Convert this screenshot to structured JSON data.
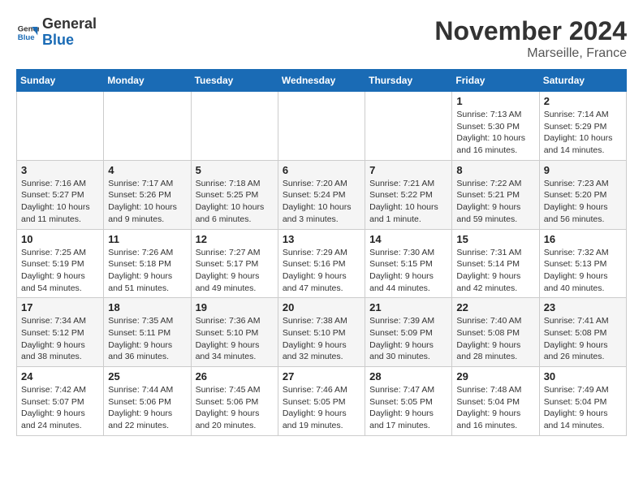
{
  "header": {
    "logo_general": "General",
    "logo_blue": "Blue",
    "month_title": "November 2024",
    "location": "Marseille, France"
  },
  "weekdays": [
    "Sunday",
    "Monday",
    "Tuesday",
    "Wednesday",
    "Thursday",
    "Friday",
    "Saturday"
  ],
  "weeks": [
    [
      {
        "day": "",
        "info": ""
      },
      {
        "day": "",
        "info": ""
      },
      {
        "day": "",
        "info": ""
      },
      {
        "day": "",
        "info": ""
      },
      {
        "day": "",
        "info": ""
      },
      {
        "day": "1",
        "info": "Sunrise: 7:13 AM\nSunset: 5:30 PM\nDaylight: 10 hours\nand 16 minutes."
      },
      {
        "day": "2",
        "info": "Sunrise: 7:14 AM\nSunset: 5:29 PM\nDaylight: 10 hours\nand 14 minutes."
      }
    ],
    [
      {
        "day": "3",
        "info": "Sunrise: 7:16 AM\nSunset: 5:27 PM\nDaylight: 10 hours\nand 11 minutes."
      },
      {
        "day": "4",
        "info": "Sunrise: 7:17 AM\nSunset: 5:26 PM\nDaylight: 10 hours\nand 9 minutes."
      },
      {
        "day": "5",
        "info": "Sunrise: 7:18 AM\nSunset: 5:25 PM\nDaylight: 10 hours\nand 6 minutes."
      },
      {
        "day": "6",
        "info": "Sunrise: 7:20 AM\nSunset: 5:24 PM\nDaylight: 10 hours\nand 3 minutes."
      },
      {
        "day": "7",
        "info": "Sunrise: 7:21 AM\nSunset: 5:22 PM\nDaylight: 10 hours\nand 1 minute."
      },
      {
        "day": "8",
        "info": "Sunrise: 7:22 AM\nSunset: 5:21 PM\nDaylight: 9 hours\nand 59 minutes."
      },
      {
        "day": "9",
        "info": "Sunrise: 7:23 AM\nSunset: 5:20 PM\nDaylight: 9 hours\nand 56 minutes."
      }
    ],
    [
      {
        "day": "10",
        "info": "Sunrise: 7:25 AM\nSunset: 5:19 PM\nDaylight: 9 hours\nand 54 minutes."
      },
      {
        "day": "11",
        "info": "Sunrise: 7:26 AM\nSunset: 5:18 PM\nDaylight: 9 hours\nand 51 minutes."
      },
      {
        "day": "12",
        "info": "Sunrise: 7:27 AM\nSunset: 5:17 PM\nDaylight: 9 hours\nand 49 minutes."
      },
      {
        "day": "13",
        "info": "Sunrise: 7:29 AM\nSunset: 5:16 PM\nDaylight: 9 hours\nand 47 minutes."
      },
      {
        "day": "14",
        "info": "Sunrise: 7:30 AM\nSunset: 5:15 PM\nDaylight: 9 hours\nand 44 minutes."
      },
      {
        "day": "15",
        "info": "Sunrise: 7:31 AM\nSunset: 5:14 PM\nDaylight: 9 hours\nand 42 minutes."
      },
      {
        "day": "16",
        "info": "Sunrise: 7:32 AM\nSunset: 5:13 PM\nDaylight: 9 hours\nand 40 minutes."
      }
    ],
    [
      {
        "day": "17",
        "info": "Sunrise: 7:34 AM\nSunset: 5:12 PM\nDaylight: 9 hours\nand 38 minutes."
      },
      {
        "day": "18",
        "info": "Sunrise: 7:35 AM\nSunset: 5:11 PM\nDaylight: 9 hours\nand 36 minutes."
      },
      {
        "day": "19",
        "info": "Sunrise: 7:36 AM\nSunset: 5:10 PM\nDaylight: 9 hours\nand 34 minutes."
      },
      {
        "day": "20",
        "info": "Sunrise: 7:38 AM\nSunset: 5:10 PM\nDaylight: 9 hours\nand 32 minutes."
      },
      {
        "day": "21",
        "info": "Sunrise: 7:39 AM\nSunset: 5:09 PM\nDaylight: 9 hours\nand 30 minutes."
      },
      {
        "day": "22",
        "info": "Sunrise: 7:40 AM\nSunset: 5:08 PM\nDaylight: 9 hours\nand 28 minutes."
      },
      {
        "day": "23",
        "info": "Sunrise: 7:41 AM\nSunset: 5:08 PM\nDaylight: 9 hours\nand 26 minutes."
      }
    ],
    [
      {
        "day": "24",
        "info": "Sunrise: 7:42 AM\nSunset: 5:07 PM\nDaylight: 9 hours\nand 24 minutes."
      },
      {
        "day": "25",
        "info": "Sunrise: 7:44 AM\nSunset: 5:06 PM\nDaylight: 9 hours\nand 22 minutes."
      },
      {
        "day": "26",
        "info": "Sunrise: 7:45 AM\nSunset: 5:06 PM\nDaylight: 9 hours\nand 20 minutes."
      },
      {
        "day": "27",
        "info": "Sunrise: 7:46 AM\nSunset: 5:05 PM\nDaylight: 9 hours\nand 19 minutes."
      },
      {
        "day": "28",
        "info": "Sunrise: 7:47 AM\nSunset: 5:05 PM\nDaylight: 9 hours\nand 17 minutes."
      },
      {
        "day": "29",
        "info": "Sunrise: 7:48 AM\nSunset: 5:04 PM\nDaylight: 9 hours\nand 16 minutes."
      },
      {
        "day": "30",
        "info": "Sunrise: 7:49 AM\nSunset: 5:04 PM\nDaylight: 9 hours\nand 14 minutes."
      }
    ]
  ]
}
